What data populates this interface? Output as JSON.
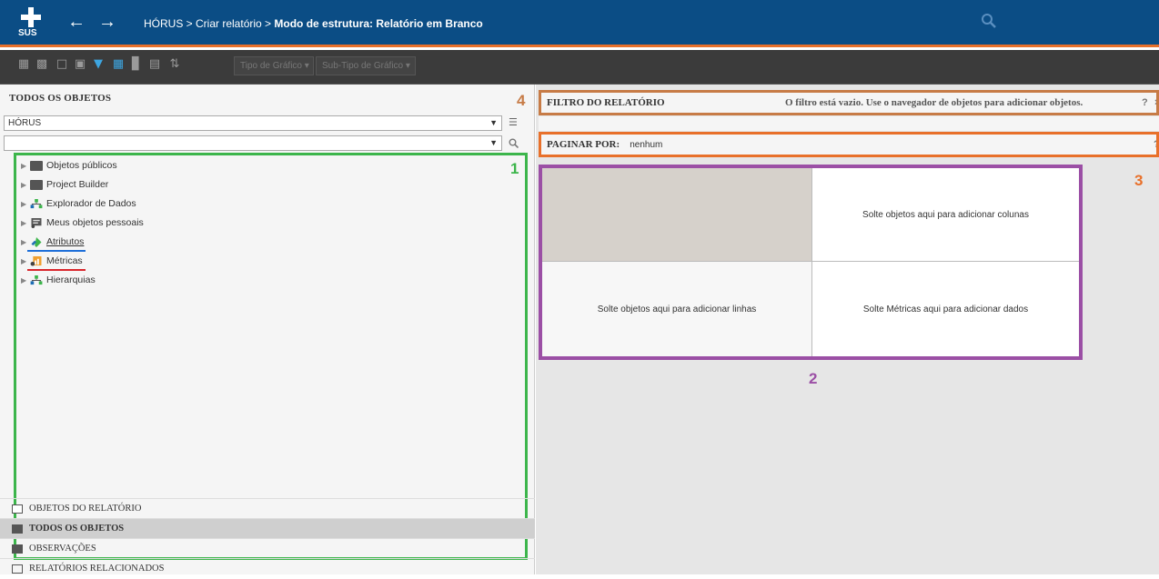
{
  "header": {
    "logo_text": "SUS",
    "breadcrumb_prefix": "HÓRUS > Criar relatório > ",
    "breadcrumb_current": "Modo de estrutura: Relatório em Branco"
  },
  "toolbar": {
    "chart_type_label": "Tipo de Gráfico",
    "chart_subtype_label": "Sub-Tipo de Gráfico"
  },
  "left_panel": {
    "title": "TODOS OS OBJETOS",
    "project_select": "HÓRUS",
    "search_value": "",
    "tree_items": [
      {
        "label": "Objetos públicos",
        "icon": "folder-icon"
      },
      {
        "label": "Project Builder",
        "icon": "folder-icon"
      },
      {
        "label": "Explorador de Dados",
        "icon": "hierarchy-icon"
      },
      {
        "label": "Meus objetos pessoais",
        "icon": "personal-objects-icon"
      },
      {
        "label": "Atributos",
        "icon": "attribute-icon"
      },
      {
        "label": "Métricas",
        "icon": "metric-icon"
      },
      {
        "label": "Hierarquias",
        "icon": "hierarchy-icon"
      }
    ],
    "bottom_tabs": [
      {
        "label": "OBJETOS DO RELATÓRIO",
        "selected": false
      },
      {
        "label": "TODOS OS OBJETOS",
        "selected": true
      },
      {
        "label": "OBSERVAÇÕES",
        "selected": false
      },
      {
        "label": "RELATÓRIOS RELACIONADOS",
        "selected": false
      }
    ]
  },
  "report": {
    "filter_label": "FILTRO DO RELATÓRIO",
    "filter_empty_text": "O filtro está vazio. Use o navegador de objetos para adicionar objetos.",
    "filter_help": "?",
    "filter_close": "×",
    "page_by_label": "PAGINAR POR:",
    "page_by_value": "nenhum",
    "page_by_help": "?",
    "drop_columns": "Solte objetos aqui para adicionar colunas",
    "drop_rows": "Solte objetos aqui para adicionar linhas",
    "drop_metrics": "Solte Métricas aqui para adicionar dados"
  },
  "annotations": {
    "n1": "1",
    "n2": "2",
    "n3": "3",
    "n4": "4"
  },
  "colors": {
    "header_bg": "#0b4d85",
    "accent_orange": "#e8702a",
    "tree_highlight": "#3cb54b",
    "grid_highlight": "#9b4fa5",
    "attribute_underline": "#1e6fd9",
    "metric_underline": "#d9262c"
  }
}
